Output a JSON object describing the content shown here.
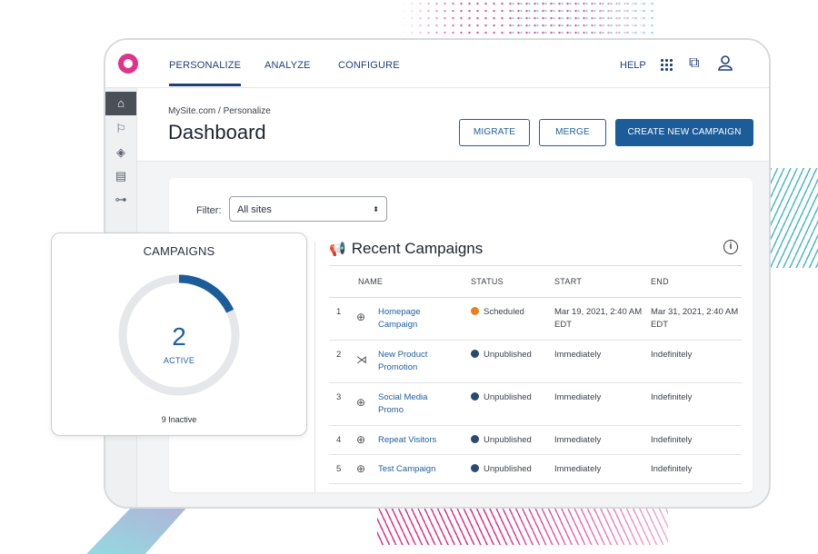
{
  "nav": {
    "items": [
      "PERSONALIZE",
      "ANALYZE",
      "CONFIGURE"
    ],
    "help": "HELP"
  },
  "breadcrumb": "MySite.com / Personalize",
  "page_title": "Dashboard",
  "buttons": {
    "migrate": "MIGRATE",
    "merge": "MERGE",
    "create": "CREATE NEW CAMPAIGN"
  },
  "filter": {
    "label": "Filter:",
    "value": "All sites"
  },
  "recent": {
    "title": "Recent Campaigns",
    "columns": [
      "NAME",
      "STATUS",
      "START",
      "END"
    ],
    "rows": [
      {
        "num": "1",
        "icon": "target-icon",
        "name": "Homepage Campaign",
        "status": "Scheduled",
        "status_color": "#e8821e",
        "start": "Mar 19, 2021, 2:40 AM EDT",
        "end": "Mar 31, 2021, 2:40 AM EDT"
      },
      {
        "num": "2",
        "icon": "split-icon",
        "name": "New Product Promotion",
        "status": "Unpublished",
        "status_color": "#2b4a6f",
        "start": "Immediately",
        "end": "Indefinitely"
      },
      {
        "num": "3",
        "icon": "target-icon",
        "name": "Social Media Promo",
        "status": "Unpublished",
        "status_color": "#2b4a6f",
        "start": "Immediately",
        "end": "Indefinitely"
      },
      {
        "num": "4",
        "icon": "target-icon",
        "name": "Repeat Visitors",
        "status": "Unpublished",
        "status_color": "#2b4a6f",
        "start": "Immediately",
        "end": "Indefinitely"
      },
      {
        "num": "5",
        "icon": "target-icon",
        "name": "Test Campaign",
        "status": "Unpublished",
        "status_color": "#2b4a6f",
        "start": "Immediately",
        "end": "Indefinitely"
      }
    ]
  },
  "campaigns_widget": {
    "title": "CAMPAIGNS",
    "active_count": "2",
    "active_label": "ACTIVE",
    "inactive_label": "9 Inactive",
    "active_fraction": 0.18
  },
  "colors": {
    "brand": "#e0338a",
    "primary": "#1b5c99",
    "link": "#1f5fa0"
  }
}
